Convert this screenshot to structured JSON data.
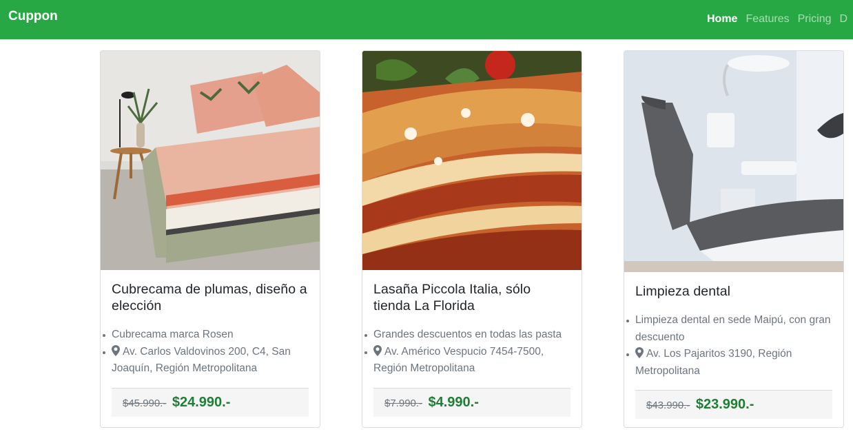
{
  "navbar": {
    "brand": "Cuppon",
    "links": [
      "Home",
      "Features",
      "Pricing",
      "D"
    ]
  },
  "cards": [
    {
      "title": "Cubrecama de plumas, diseño a elección",
      "description": "Cubrecama marca Rosen",
      "address": "Av. Carlos Valdovinos 200, C4, San Joaquín, Región Metropolitana",
      "old_price": "$45.990.-",
      "new_price": "$24.990.-",
      "image_icon": "bedspread-photo"
    },
    {
      "title": "Lasaña Piccola Italia, sólo tienda La Florida",
      "description": "Grandes descuentos en todas las pasta",
      "address": "Av. Américo Vespucio 7454-7500, Región Metropolitana",
      "old_price": "$7.990.-",
      "new_price": "$4.990.-",
      "image_icon": "lasagna-photo"
    },
    {
      "title": "Limpieza dental",
      "description": "Limpieza dental en sede Maipú, con gran descuento",
      "address": "Av. Los Pajaritos 3190, Región Metropolitana",
      "old_price": "$43.990.-",
      "new_price": "$23.990.-",
      "image_icon": "dental-chair-photo"
    }
  ],
  "colors": {
    "navbar": "#28a745",
    "price": "#1e7e34"
  }
}
